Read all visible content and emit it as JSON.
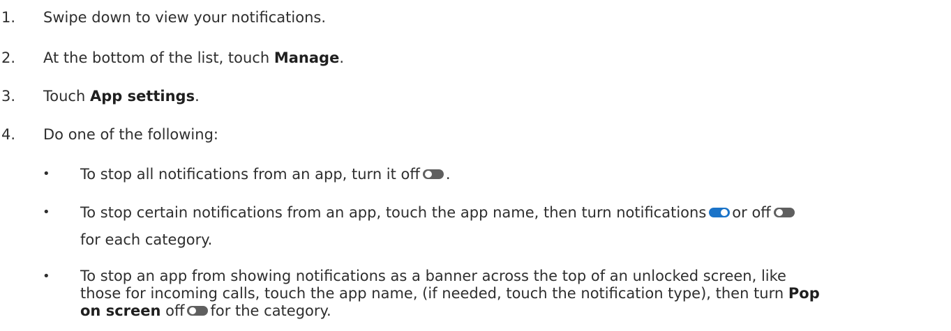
{
  "steps": [
    {
      "num": "1.",
      "text": "Swipe down to view your notifications."
    },
    {
      "num": "2.",
      "before": "At the bottom of the list, touch ",
      "bold": "Manage",
      "after": "."
    },
    {
      "num": "3.",
      "before": "Touch ",
      "bold": "App settings",
      "after": "."
    },
    {
      "num": "4.",
      "text": "Do one of the following:"
    }
  ],
  "bullets": [
    {
      "dot": "•",
      "before": "To stop all notifications from an app, turn it off",
      "after": "."
    },
    {
      "dot": "•",
      "before": "To stop certain notifications from an app, touch the app name, then turn notifications",
      "middle": "or off",
      "line2": "for each category."
    },
    {
      "dot": "•",
      "line1": "To stop an app from showing notifications as a banner across the top of an unlocked screen, like",
      "line2_before": "those for incoming calls, touch the app name, (if needed, touch the notification type), then turn",
      "line2_bold": "Pop",
      "line3_bold": "on screen",
      "line3_middle": "off",
      "line3_after": "for the category."
    }
  ],
  "toggles": {
    "off_color": "#5f5f5f",
    "on_color": "#1a73c8",
    "off_icon": "toggle-off-icon",
    "on_icon": "toggle-on-icon"
  }
}
